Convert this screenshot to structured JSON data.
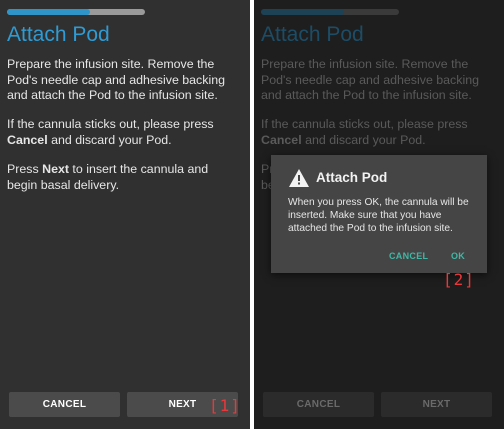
{
  "screens": [
    {
      "progress": 0.6,
      "title": "Attach Pod",
      "p1": "Prepare the infusion site. Remove the Pod's needle cap and adhesive backing and attach the Pod to the infusion site.",
      "p2_pre": "If the cannula sticks out, please press ",
      "p2_bold": "Cancel",
      "p2_post": " and discard your Pod.",
      "p3_pre": "Press ",
      "p3_bold": "Next",
      "p3_post": " to insert the cannula and begin basal delivery.",
      "cancel_label": "CANCEL",
      "next_label": "NEXT",
      "marker": "[1]"
    },
    {
      "progress": 0.6,
      "title": "Attach Pod",
      "p1": "Prepare the infusion site. Remove the Pod's needle cap and adhesive backing and attach the Pod to the infusion site.",
      "p2_pre": "If the cannula sticks out, please press ",
      "p2_bold": "Cancel",
      "p2_post": " and discard your Pod.",
      "p3_pre": "Pr",
      "p3_bold": "",
      "p3_post": "be",
      "cancel_label": "CANCEL",
      "next_label": "NEXT"
    }
  ],
  "dialog": {
    "icon": "warning-icon",
    "title": "Attach Pod",
    "message": "When you press OK, the cannula will be inserted. Make sure that you have attached the Pod to the infusion site.",
    "cancel_label": "CANCEL",
    "ok_label": "OK",
    "marker": "[2]"
  },
  "colors": {
    "accent": "#2f9bd2",
    "dialog_button": "#3fb8a6",
    "marker": "#e8383b"
  }
}
